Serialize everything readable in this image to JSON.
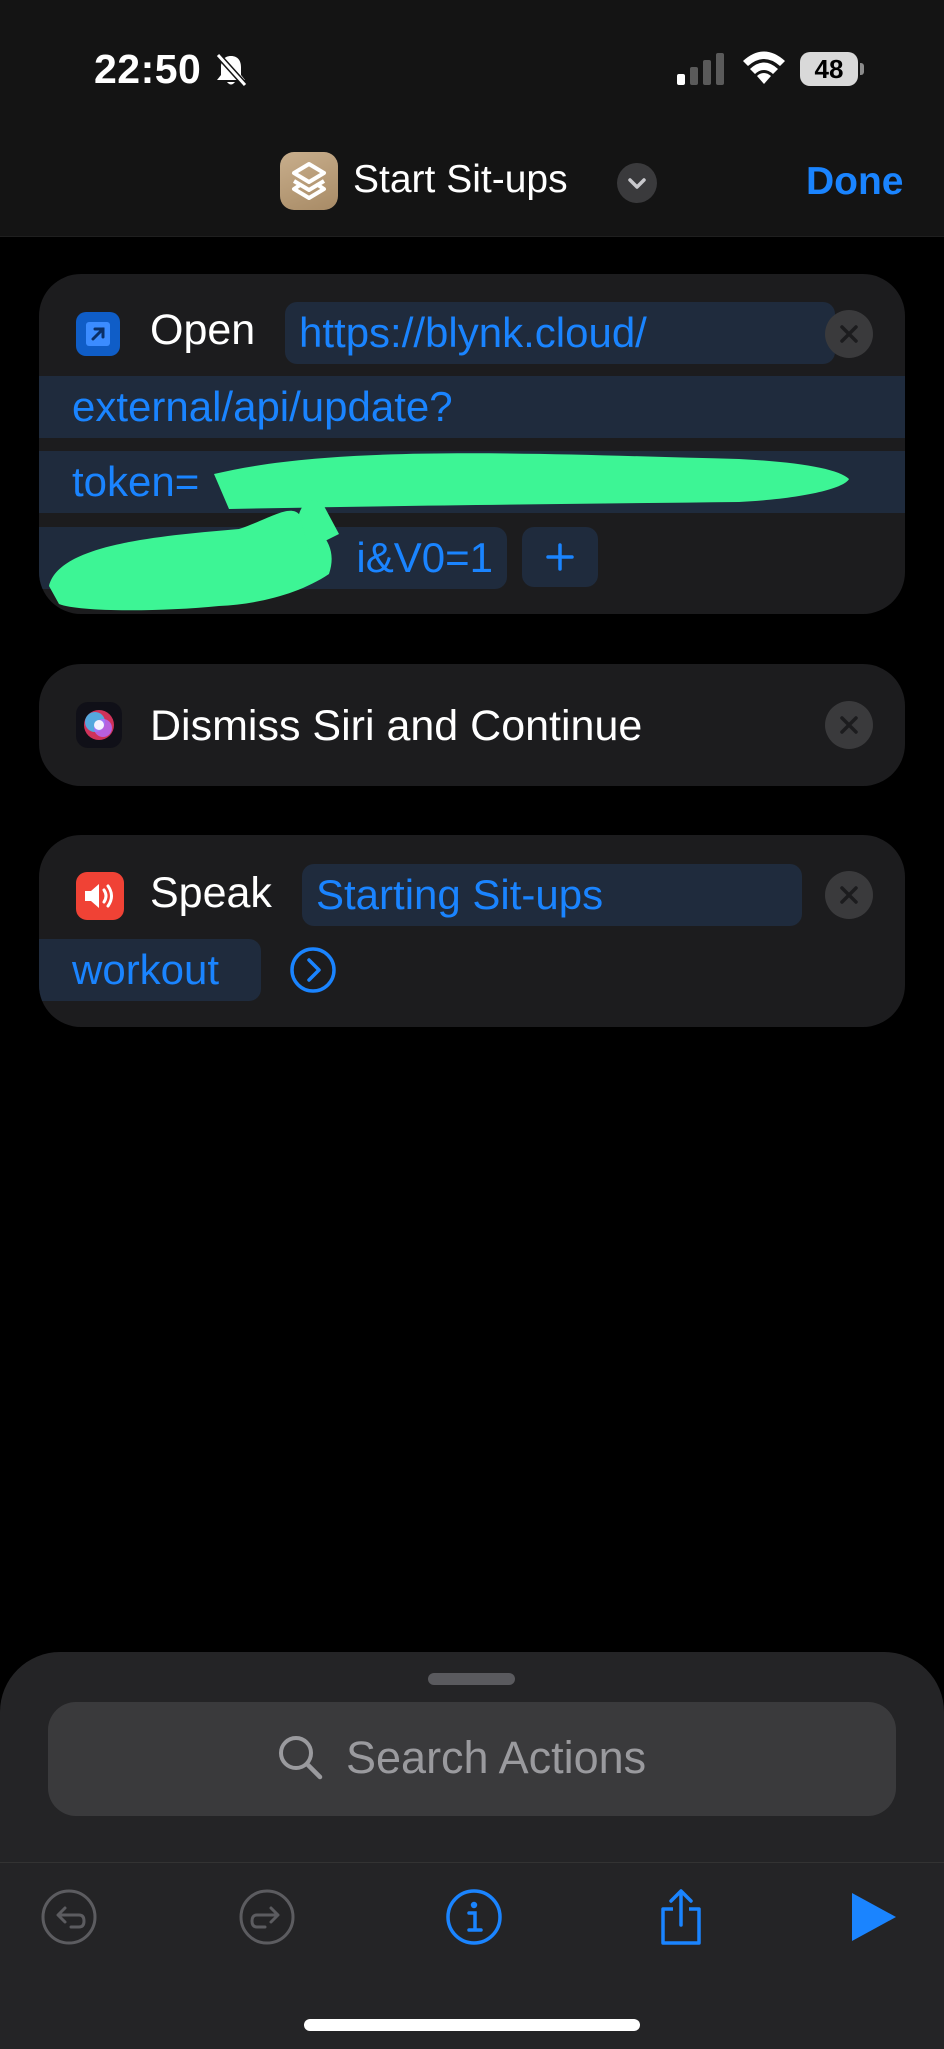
{
  "status_bar": {
    "time": "22:50",
    "battery": "48"
  },
  "nav": {
    "title": "Start Sit-ups",
    "done_label": "Done"
  },
  "actions": [
    {
      "label": "Open",
      "url_lines": [
        "https://blynk.cloud/",
        "external/api/update?",
        "token=",
        "i&V0=1"
      ]
    },
    {
      "label": "Dismiss Siri and Continue"
    },
    {
      "label": "Speak",
      "text_lines": [
        "Starting Sit-ups",
        "workout"
      ]
    }
  ],
  "search": {
    "placeholder": "Search Actions"
  },
  "toolbar": {
    "icons": [
      "undo-icon",
      "redo-icon",
      "info-icon",
      "share-icon",
      "play-icon"
    ]
  },
  "colors": {
    "accent": "#1a84ff",
    "card": "#1c1c1e",
    "token_bg": "#1f2b3d",
    "redaction": "#3df595"
  }
}
